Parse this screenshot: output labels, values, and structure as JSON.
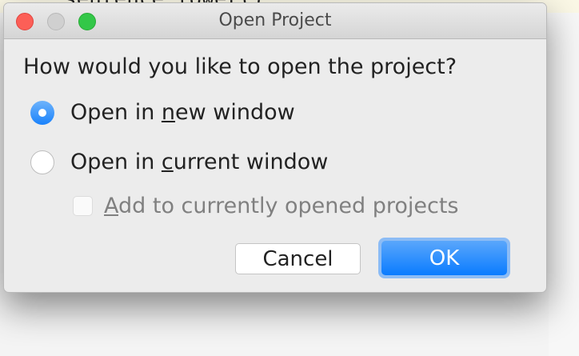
{
  "background": {
    "code_fragment": "sentence.lower()"
  },
  "dialog": {
    "title": "Open Project",
    "question": "How would you like to open the project?",
    "options": [
      {
        "pre": "Open in ",
        "mnemonic": "n",
        "post": "ew window",
        "selected": true
      },
      {
        "pre": "Open in ",
        "mnemonic": "c",
        "post": "urrent window",
        "selected": false
      }
    ],
    "checkbox": {
      "mnemonic": "A",
      "post": "dd to currently opened projects",
      "checked": false,
      "enabled": false
    },
    "buttons": {
      "cancel": "Cancel",
      "ok": "OK"
    },
    "accent_color": "#1a82fb"
  }
}
